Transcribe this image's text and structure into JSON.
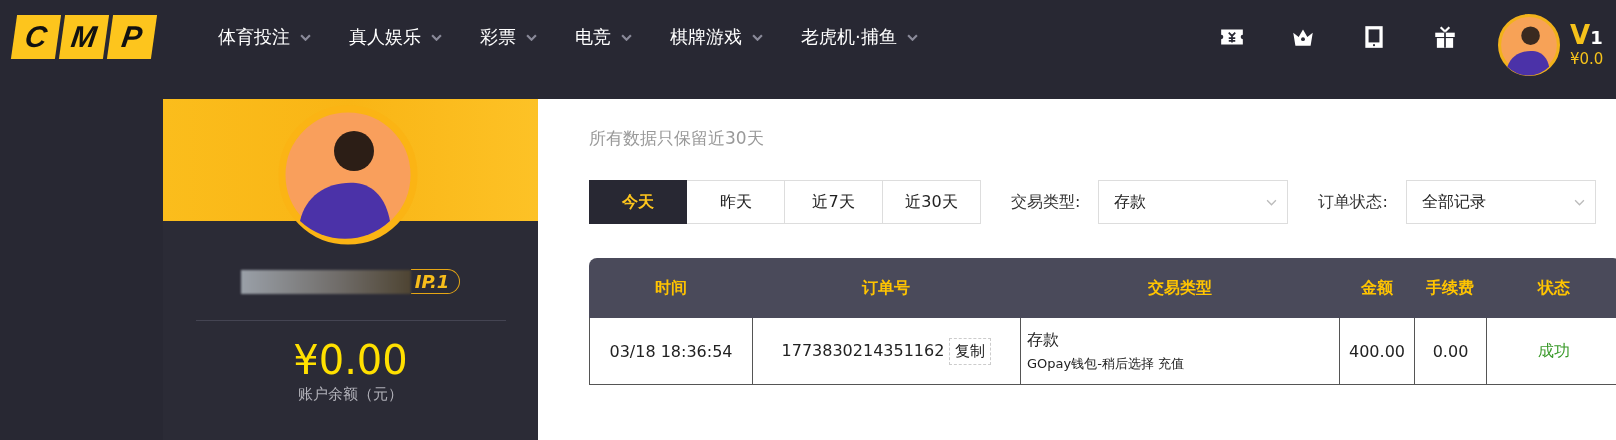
{
  "header": {
    "logo": [
      "C",
      "M",
      "P"
    ],
    "nav": [
      {
        "label": "体育投注"
      },
      {
        "label": "真人娱乐"
      },
      {
        "label": "彩票"
      },
      {
        "label": "电竞"
      },
      {
        "label": "棋牌游戏"
      },
      {
        "label": "老虎机·捕鱼"
      }
    ],
    "user": {
      "level": "V",
      "level_num": "1",
      "balance": "¥0.0"
    }
  },
  "profile": {
    "vip": "IP.1",
    "balance": "¥0.00",
    "balance_label": "账户余额（元）"
  },
  "page": {
    "subtitle": "所有数据只保留近30天",
    "ranges": [
      {
        "label": "今天",
        "selected": true
      },
      {
        "label": "昨天",
        "selected": false
      },
      {
        "label": "近7天",
        "selected": false
      },
      {
        "label": "近30天",
        "selected": false
      }
    ],
    "filters": [
      {
        "label": "交易类型:",
        "value": "存款"
      },
      {
        "label": "订单状态:",
        "value": "全部记录"
      }
    ],
    "table": {
      "columns": [
        "时间",
        "订单号",
        "交易类型",
        "金额",
        "手续费",
        "状态"
      ],
      "rows": [
        {
          "time": "03/18 18:36:54",
          "order": "1773830214351162",
          "copy": "复制",
          "type": "存款",
          "detail": "GOpay钱包-稍后选择 充值",
          "amount": "400.00",
          "fee": "0.00",
          "status": "成功",
          "color": "#3a9a2a"
        }
      ]
    }
  }
}
